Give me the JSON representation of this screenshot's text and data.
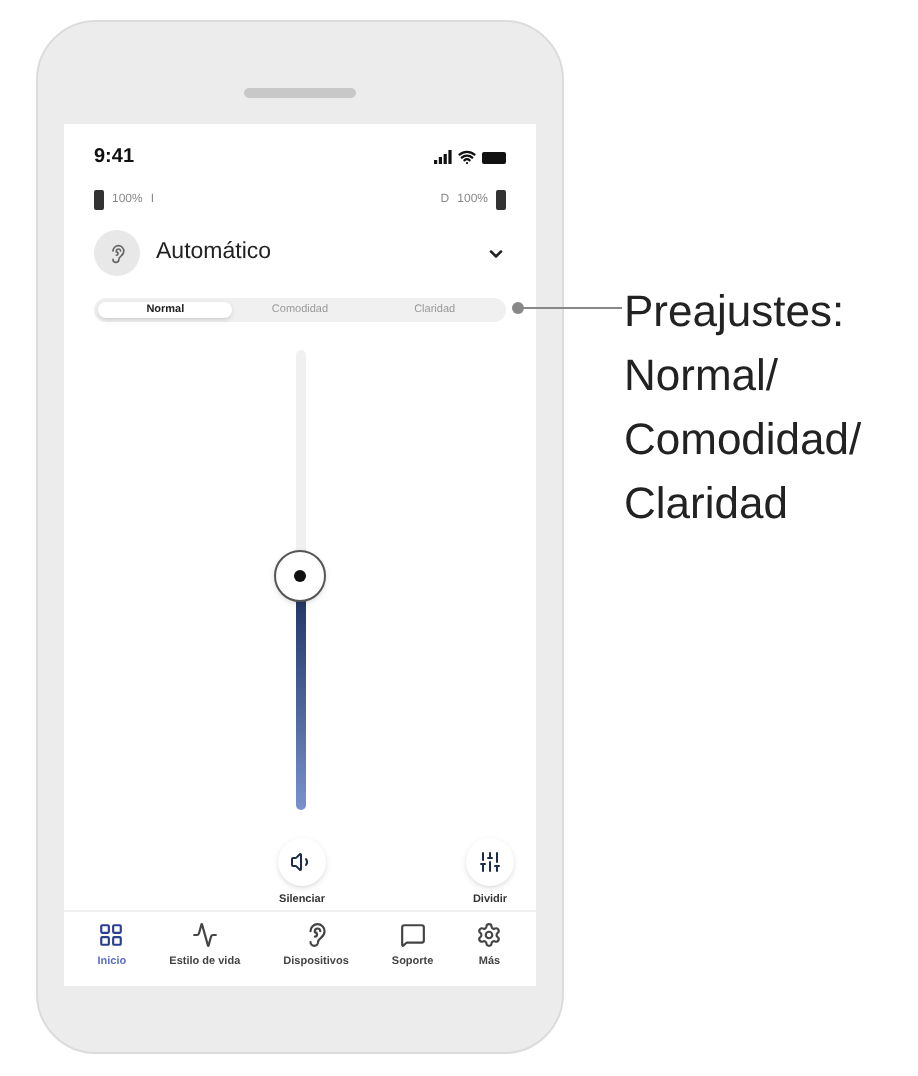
{
  "status_bar": {
    "time": "9:41"
  },
  "batteries": [
    {
      "kind": "left",
      "percent": "100%",
      "letter": "I"
    },
    {
      "kind": "right",
      "percent": "100%",
      "letter": "D"
    }
  ],
  "program": {
    "name": "Automático"
  },
  "presets": [
    {
      "label": "Normal",
      "selected": true
    },
    {
      "label": "Comodidad",
      "selected": false
    },
    {
      "label": "Claridad",
      "selected": false
    }
  ],
  "volume": {
    "level": 0.51
  },
  "actions": [
    {
      "kind": "mute",
      "label": "Silenciar"
    },
    {
      "kind": "split",
      "label": "Dividir"
    }
  ],
  "nav": [
    {
      "kind": "home",
      "label": "Inicio",
      "selected": true
    },
    {
      "kind": "lifestyle",
      "label": "Estilo de vida",
      "selected": false
    },
    {
      "kind": "devices",
      "label": "Dispositivos",
      "selected": false
    },
    {
      "kind": "support",
      "label": "Soporte",
      "selected": false
    },
    {
      "kind": "more",
      "label": "Más",
      "selected": false
    }
  ],
  "annotation": {
    "lines": [
      "Preajustes:",
      "Normal/",
      "Comodidad/",
      "Claridad"
    ]
  }
}
